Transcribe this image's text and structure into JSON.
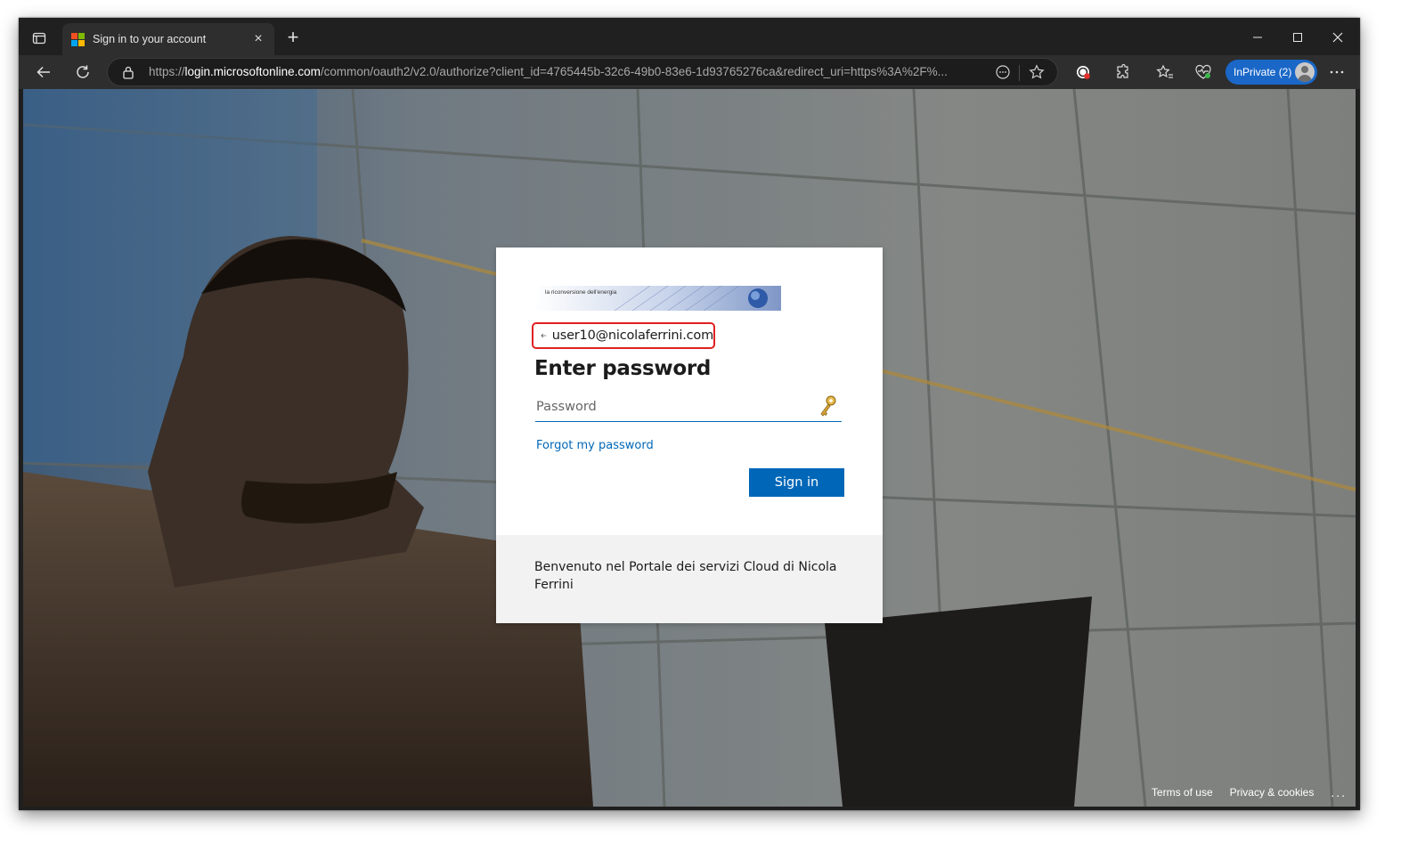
{
  "browser": {
    "tab_title": "Sign in to your account",
    "tab_close": "×",
    "new_tab": "+",
    "url_prefix": "https://",
    "url_host": "login.microsoftonline.com",
    "url_path": "/common/oauth2/v2.0/authorize?client_id=4765445b-32c6-49b0-83e6-1d93765276ca&redirect_uri=https%3A%2F%...",
    "inprivate_label": "InPrivate (2)",
    "icons": [
      "tab-actions-icon",
      "back-icon",
      "refresh-icon",
      "lock-icon",
      "reading-mode-icon",
      "favorite-star-icon",
      "adblock-icon",
      "extensions-icon",
      "favorites-icon",
      "browser-essentials-icon",
      "more-icon"
    ]
  },
  "signin": {
    "logo_text": "la riconversione dell'energia",
    "identity_email": "user10@nicolaferrini.com",
    "heading": "Enter password",
    "password_placeholder": "Password",
    "forgot_link": "Forgot my password",
    "signin_button": "Sign in",
    "banner_text": "Benvenuto nel Portale dei servizi Cloud di Nicola Ferrini"
  },
  "footer": {
    "terms": "Terms of use",
    "privacy": "Privacy & cookies",
    "more": "..."
  },
  "colors": {
    "accent": "#0067b8",
    "highlight_border": "#e02020",
    "inprivate": "#1a67c8"
  }
}
